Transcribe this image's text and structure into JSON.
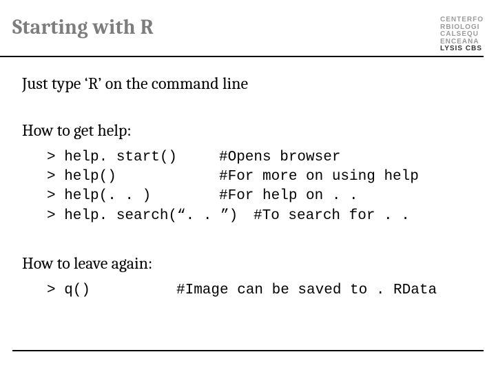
{
  "header": {
    "title": "Starting with R",
    "logo_lines": {
      "l1": "CENTERFO",
      "l2": "RBIOLOGI",
      "l3": "CALSEQU",
      "l4": "ENCEANA",
      "l5": "LYSIS CBS"
    }
  },
  "lead": "Just type ‘R’ on the command line",
  "help": {
    "heading": "How to get help:",
    "rows": [
      {
        "cmd": "> help. start()",
        "comment": "#Opens browser"
      },
      {
        "cmd": "> help()",
        "comment": "#For more on using help"
      },
      {
        "cmd": "> help(. . )",
        "comment": "#For help on . ."
      },
      {
        "cmd": "> help. search(“. . ”)",
        "comment": "#To search for . ."
      }
    ]
  },
  "leave": {
    "heading": "How to leave again:",
    "rows": [
      {
        "cmd": "> q()",
        "comment": "#Image can be saved to . RData"
      }
    ]
  }
}
